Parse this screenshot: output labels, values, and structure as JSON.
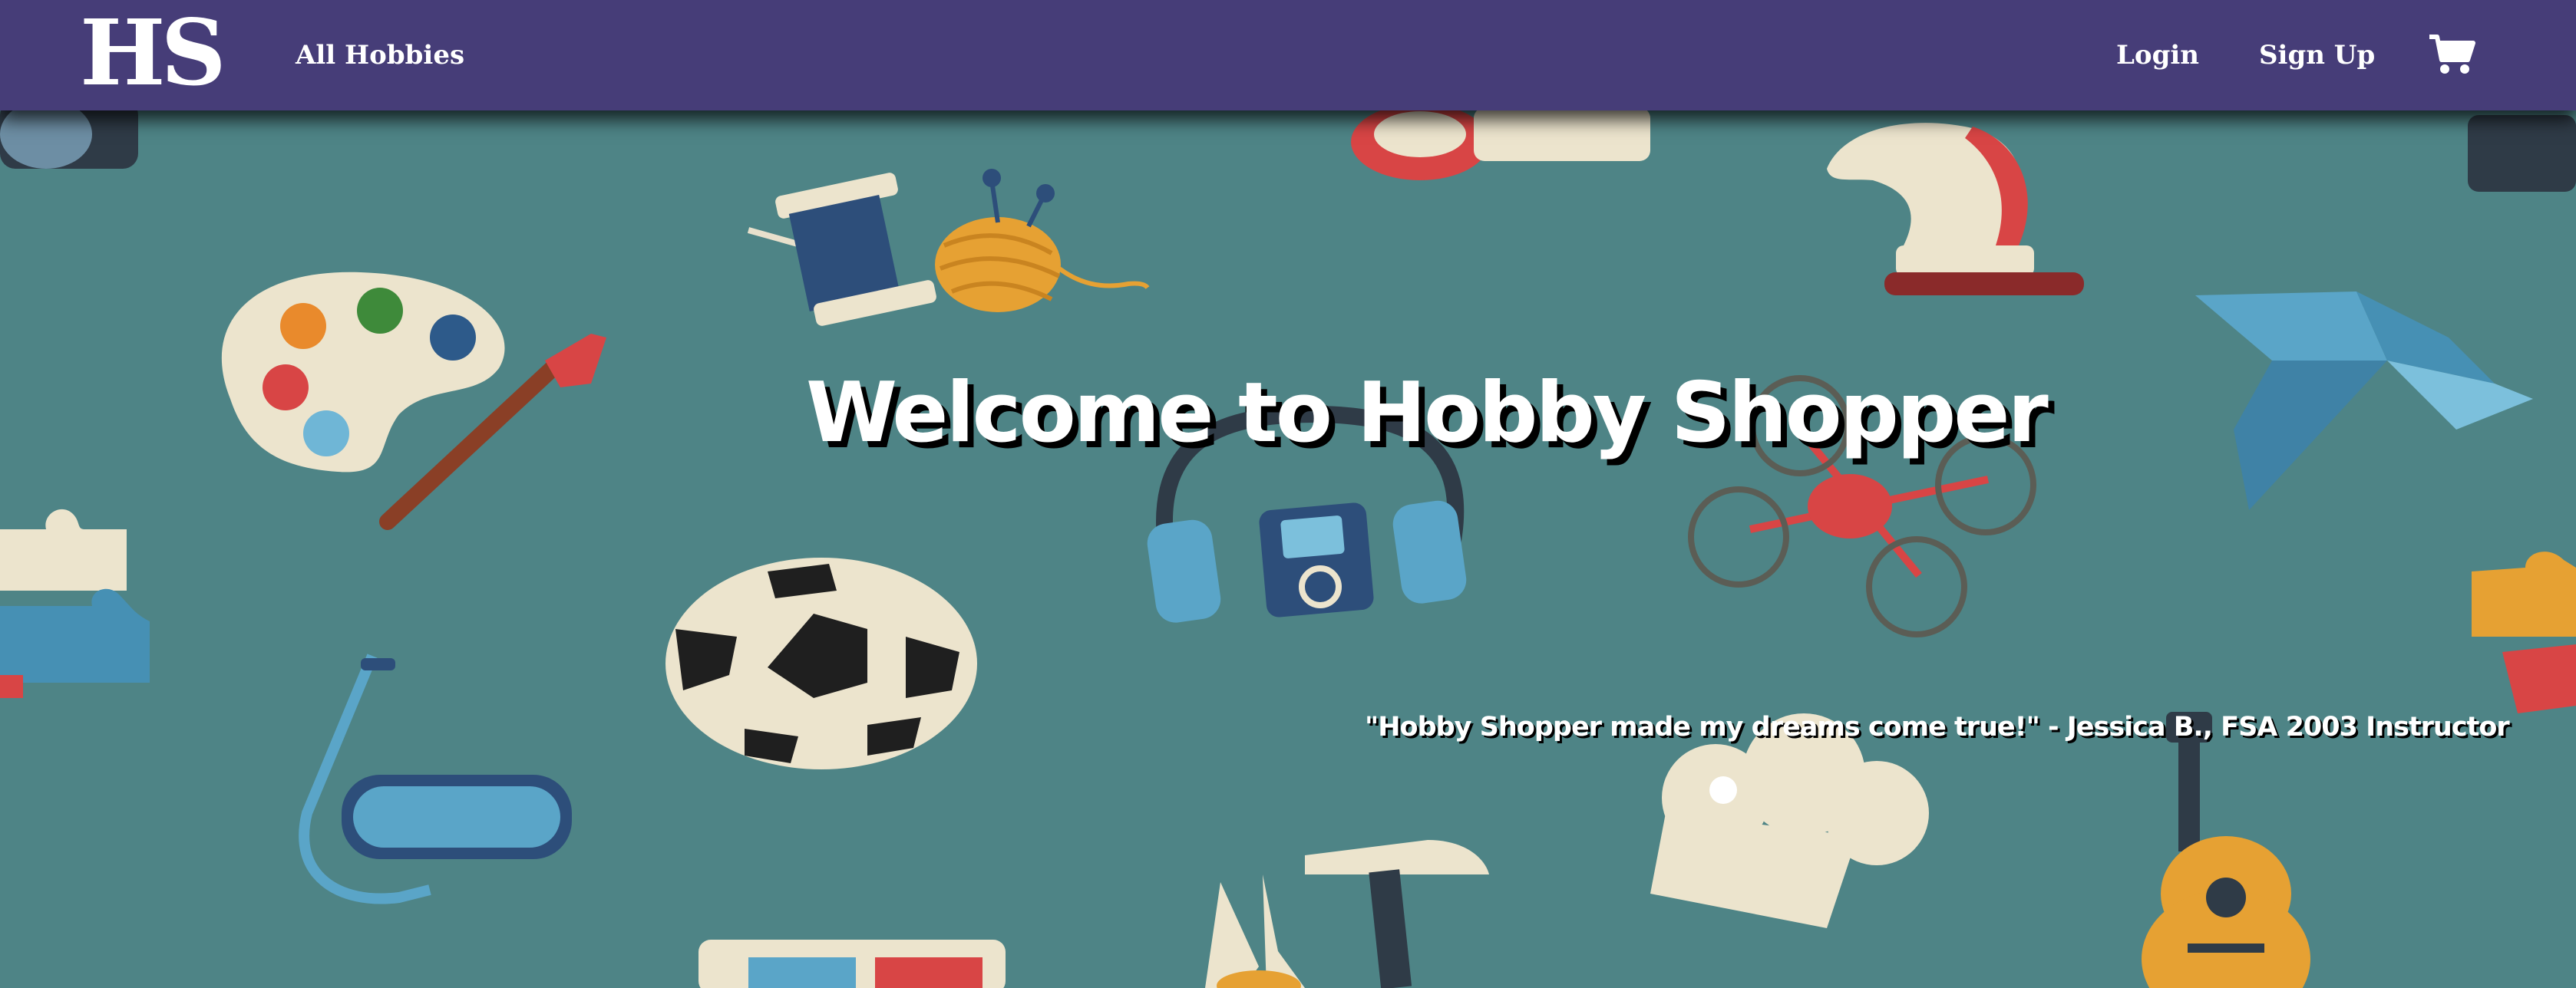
{
  "navbar": {
    "logo_text": "HS",
    "all_hobbies_label": "All Hobbies",
    "login_label": "Login",
    "signup_label": "Sign Up",
    "cart_icon": "shopping-cart-icon"
  },
  "hero": {
    "headline": "Welcome to Hobby Shopper",
    "quote": "\"Hobby Shopper made my dreams come true!\" - Jessica B., FSA 2003 Instructor"
  },
  "background": {
    "icons": [
      "palette-icon",
      "paintbrush-icon",
      "thread-spool-icon",
      "yarn-ball-icon",
      "poker-chip-icon",
      "chess-knight-icon",
      "origami-bird-icon",
      "headphones-icon",
      "music-player-icon",
      "drone-icon",
      "soccer-ball-icon",
      "puzzle-piece-icon",
      "snorkel-mask-icon",
      "chef-hat-icon",
      "hammer-icon",
      "pliers-icon",
      "guitar-icon",
      "3d-glasses-icon",
      "camera-lens-icon"
    ],
    "color": "#4e8486"
  },
  "colors": {
    "navbar": "#463d78",
    "text": "#ffffff"
  }
}
